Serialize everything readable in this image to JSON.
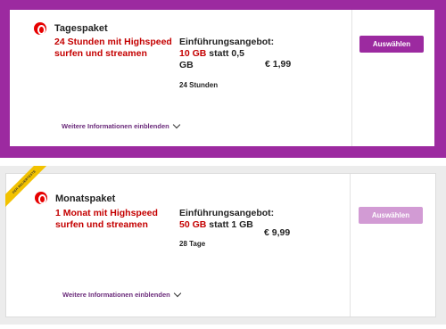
{
  "colors": {
    "accent": "#9c2aa0",
    "accent_muted": "#d29bd4",
    "highlight_red": "#c40000",
    "ribbon": "#f2c200",
    "logo": "#e60000"
  },
  "plans": [
    {
      "title": "Tagespaket",
      "speed_line1": "24 Stunden mit Highspeed",
      "speed_line2": "surfen und streamen",
      "offer_label": "Einführungsangebot:",
      "offer_volume": "10 GB",
      "offer_rest": " statt 0,5",
      "offer_rest2": "GB",
      "price": "€ 1,99",
      "duration": "24 Stunden",
      "more_info": "Weitere Informationen einblenden",
      "button": "Auswählen",
      "logo_icon": "vodafone-logo-icon"
    },
    {
      "ribbon": "DER BELIEBTESTE",
      "title": "Monatspaket",
      "speed_line1": "1 Monat mit Highspeed",
      "speed_line2": "surfen und streamen",
      "offer_label": "Einführungsangebot:",
      "offer_volume": "50 GB",
      "offer_rest": " statt 1 GB",
      "price": "€ 9,99",
      "duration": "28 Tage",
      "more_info": "Weitere Informationen einblenden",
      "button": "Auswählen",
      "logo_icon": "vodafone-logo-icon"
    }
  ]
}
